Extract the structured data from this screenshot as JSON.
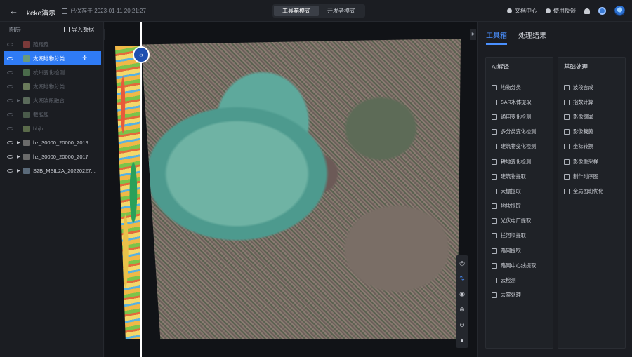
{
  "topbar": {
    "back_icon": "arrow-left-icon",
    "project_name": "keke演示",
    "saved_text": "已保存于 2023-01-11 20:21:27",
    "modes": [
      "工具箱模式",
      "开发者模式"
    ],
    "active_mode": "工具箱模式",
    "docs_label": "文档中心",
    "feedback_label": "使用反馈"
  },
  "layers": {
    "title": "图层",
    "import_label": "导入数据",
    "items": [
      {
        "name": "跑跑跑",
        "state": "dim",
        "thumb": "#7a3a3a"
      },
      {
        "name": "太湖地物分类",
        "state": "selected",
        "thumb": "#6a9a7a"
      },
      {
        "name": "杭州变化检测",
        "state": "dim",
        "thumb": "#4a6a4a"
      },
      {
        "name": "太湖地物分类",
        "state": "dim",
        "thumb": "#6a7a5a"
      },
      {
        "name": "大湖波段融合",
        "state": "dim",
        "thumb": "#5a6a5a",
        "caret": true
      },
      {
        "name": "截能能",
        "state": "dim",
        "thumb": "#4a5a4a"
      },
      {
        "name": "hhjh",
        "state": "dim",
        "thumb": "#5a6a4a"
      },
      {
        "name": "hz_30000_20000_2019",
        "state": "normal",
        "thumb": "#6a6a6a",
        "caret": true
      },
      {
        "name": "hz_30000_20000_2017",
        "state": "normal",
        "thumb": "#6a6a6a",
        "caret": true
      },
      {
        "name": "S2B_MSIL2A_20220227...",
        "state": "normal",
        "thumb": "#5a6a7a",
        "caret": true
      }
    ]
  },
  "right_panel": {
    "tabs": [
      "工具箱",
      "处理结果"
    ],
    "active_tab": "工具箱",
    "ai_title": "AI解译",
    "ai_tools": [
      "地物分类",
      "SAR水体提取",
      "通用变化检测",
      "多分类变化检测",
      "建筑物变化检测",
      "耕地变化检测",
      "建筑物提取",
      "大棚提取",
      "地块提取",
      "光伏电厂提取",
      "拦河坝提取",
      "路网提取",
      "路网中心线提取",
      "云检测",
      "去雾处理"
    ],
    "basic_title": "基础处理",
    "basic_tools": [
      "波段合成",
      "指数计算",
      "影像镶嵌",
      "影像裁剪",
      "坐标转换",
      "影像重采样",
      "制作时序图",
      "全局图斑优化"
    ]
  },
  "colors": {
    "accent": "#2f7bf5",
    "panel_bg": "#1b1d22",
    "map_bg": "#111317"
  }
}
